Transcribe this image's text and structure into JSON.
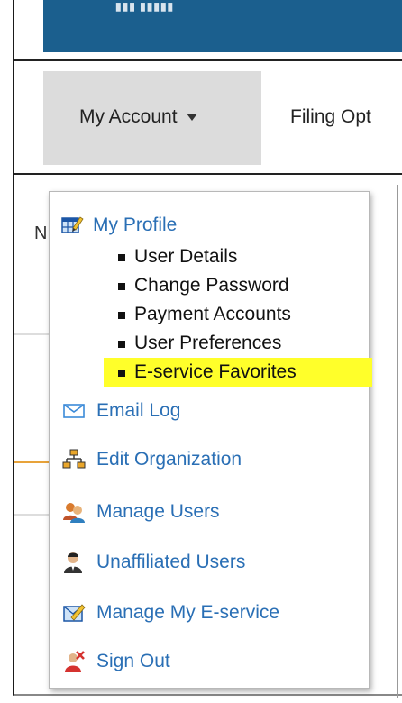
{
  "banner": {
    "logo_text": "▮▮▮ ▮▮▮▮▮"
  },
  "nav": {
    "items": [
      {
        "label": "My Account"
      },
      {
        "label": "Filing Opt"
      }
    ]
  },
  "background": {
    "fragment_n": "N"
  },
  "menu": {
    "profile": {
      "label": "My Profile",
      "icon": "profile-grid-icon",
      "subitems": [
        {
          "label": "User Details"
        },
        {
          "label": "Change Password"
        },
        {
          "label": "Payment Accounts"
        },
        {
          "label": "User Preferences"
        },
        {
          "label": "E-service Favorites",
          "highlighted": true
        }
      ]
    },
    "items": [
      {
        "label": "Email Log",
        "icon": "envelope-icon"
      },
      {
        "label": "Edit Organization",
        "icon": "org-chart-icon"
      },
      {
        "label": "Manage Users",
        "icon": "users-icon"
      },
      {
        "label": "Unaffiliated Users",
        "icon": "person-icon"
      },
      {
        "label": "Manage My E-service",
        "icon": "eservice-icon"
      },
      {
        "label": "Sign Out",
        "icon": "sign-out-icon"
      }
    ]
  },
  "colors": {
    "banner": "#1b5f8e",
    "link": "#2a6fb5",
    "highlight": "#ffff2a",
    "active_tab": "#dcdcdc"
  }
}
